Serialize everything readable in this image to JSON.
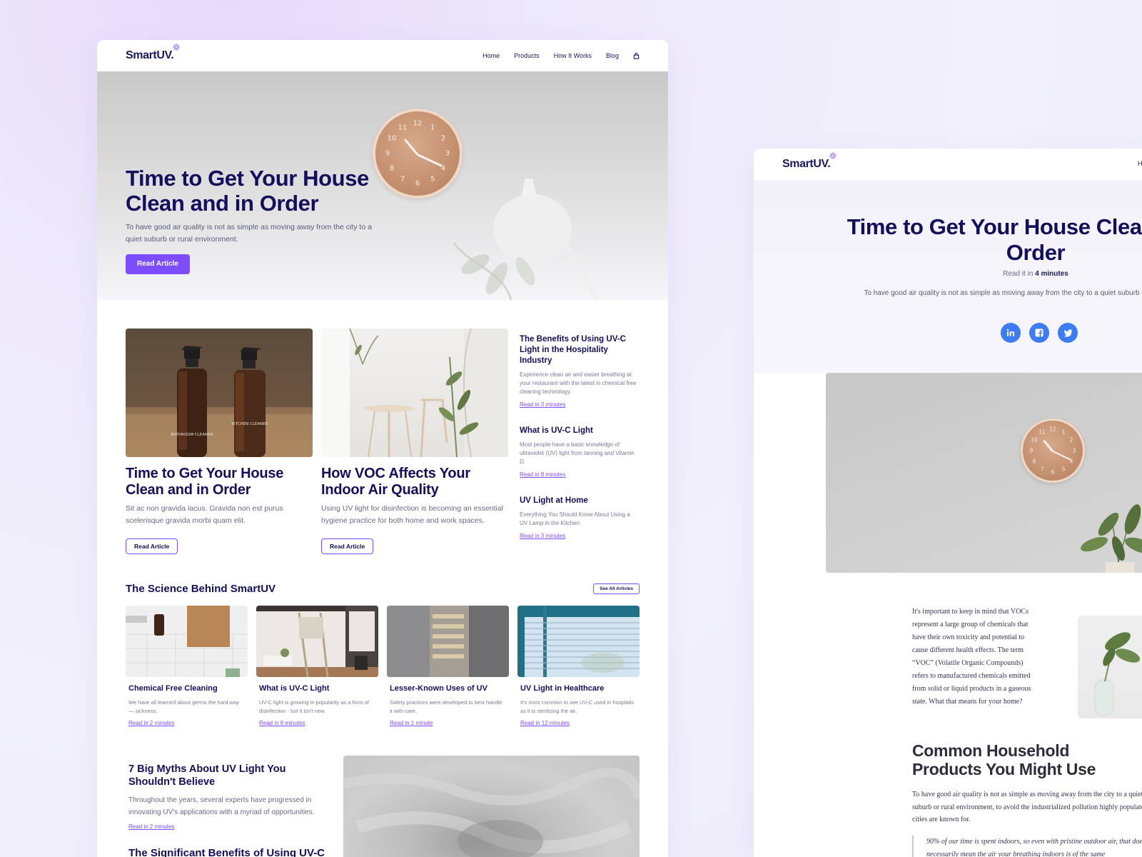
{
  "left": {
    "nav": {
      "logo": "SmartUV.",
      "links": [
        "Home",
        "Products",
        "How It Works",
        "Blog"
      ]
    },
    "hero": {
      "title": "Time to Get Your House Clean and in Order",
      "subtitle": "To have good air quality is not as simple as moving away from the city to a quiet suburb or rural environment.",
      "button": "Read Article"
    },
    "featured": [
      {
        "title": "Time to Get Your House Clean and in Order",
        "desc": "Sit ac non gravida lacus. Gravida non est purus scelerisque gravida morbi quam elit.",
        "button": "Read Article",
        "labels": [
          "BATHROOM CLEANER",
          "KITCHEN CLEANER"
        ]
      },
      {
        "title": "How VOC Affects Your Indoor Air Quality",
        "desc": "Using UV light for disinfection is becoming an essential hygiene practice for both home and work spaces.",
        "button": "Read Article"
      }
    ],
    "side": [
      {
        "title": "The Benefits of Using UV-C Light in the Hospitality Industry",
        "desc": "Experience clean air and easier breathing at your restaurant with the latest in chemical free cleaning technology.",
        "link": "Read in 3 minutes"
      },
      {
        "title": "What is UV-C Light",
        "desc": "Most people have a basic knowledge of ultraviolet (UV) light from tanning and Vitamin D.",
        "link": "Read in 8 minutes"
      },
      {
        "title": "UV Light at Home",
        "desc": "Everything You Should Know About Using a UV Lamp in the Kitchen",
        "link": "Read in 3 minutes"
      }
    ],
    "science": {
      "title": "The Science Behind SmartUV",
      "button": "See All Articles",
      "cards": [
        {
          "title": "Chemical Free Cleaning",
          "desc": "We have all learned about germs the hard way — sickness.",
          "link": "Read in 2 minutes"
        },
        {
          "title": "What is UV-C Light",
          "desc": "UV-C light is growing in popularity as a form of disinfection - but it isn't new.",
          "link": "Read in 8 minutes"
        },
        {
          "title": "Lesser-Known Uses of UV",
          "desc": "Safety practices were developed to best handle it with care.",
          "link": "Read in 1 minute"
        },
        {
          "title": "UV Light in Healthcare",
          "desc": "It's most common to see UV-C used in hospitals as it is sterilizing the air.",
          "link": "Read in 12 minutes"
        }
      ]
    },
    "myths": {
      "title": "7 Big Myths About UV Light You Shouldn't Believe",
      "desc": "Throughout the years, several experts have progressed in innovating UV's applications with a myriad of opportunities.",
      "link": "Read in 2 minutes",
      "next_title": "The Significant Benefits of Using UV-C"
    }
  },
  "right": {
    "nav": {
      "logo": "SmartUV.",
      "first_link_partial": "H"
    },
    "hero": {
      "title": "Time to Get Your House Clean and in Order",
      "read_prefix": "Read it in",
      "read_time": "4 minutes",
      "subtitle": "To have good air quality is not as simple as moving away from the city to a quiet suburb or rural environment."
    },
    "socials": [
      "linkedin-icon",
      "facebook-icon",
      "twitter-icon"
    ],
    "body": "It's important to keep in mind that VOCs represent a large group of chemicals that have their own toxicity and potential to cause different health effects. The term “VOC” (Volatile Organic Compounds) refers to manufactured chemicals emitted from solid or liquid products in a gaseous state. What that means for your home?",
    "h2": "Common Household Products You Might Use",
    "paragraph": "To have good air quality is not as simple as moving away from the city to a quiet suburb or rural environment, to avoid the industrialized pollution highly populated cities are known for.",
    "quote": "90% of our time is spent indoors, so even with pristine outdoor air, that doesn't necessarily mean the air your breathing indoors is of the same"
  },
  "colors": {
    "accent": "#7c4dff",
    "navy": "#130f5c",
    "social": "#3b7bf6"
  }
}
